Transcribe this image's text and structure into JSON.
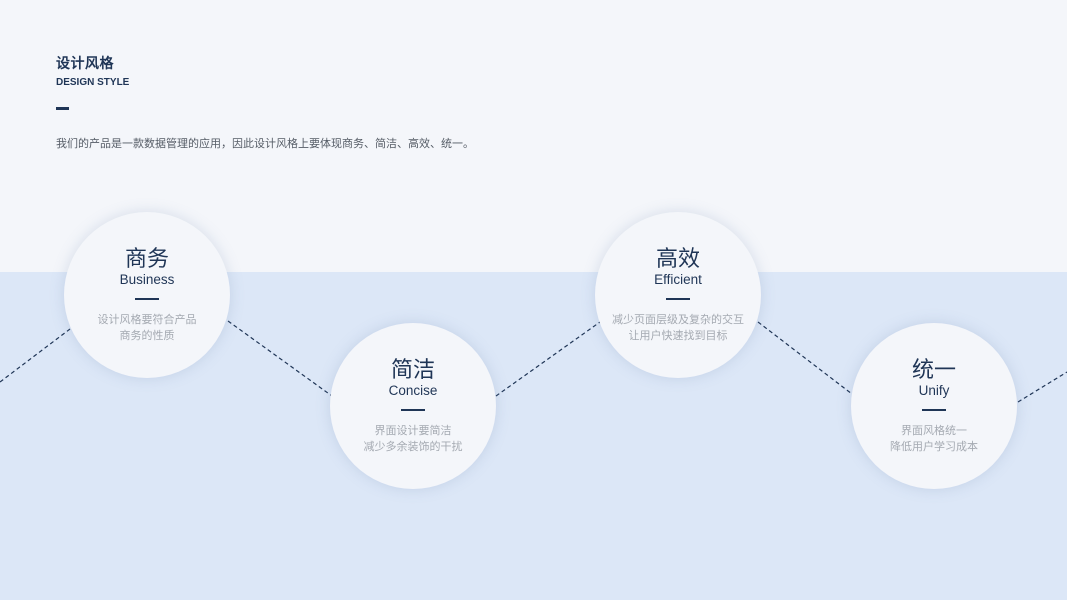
{
  "header": {
    "title_cn": "设计风格",
    "title_en": "DESIGN STYLE",
    "description": "我们的产品是一款数据管理的应用，因此设计风格上要体现商务、简洁、高效、统一。"
  },
  "styles": [
    {
      "title": "商务",
      "subtitle": "Business",
      "line1": "设计风格要符合产品",
      "line2": "商务的性质"
    },
    {
      "title": "简洁",
      "subtitle": "Concise",
      "line1": "界面设计要简洁",
      "line2": "减少多余装饰的干扰"
    },
    {
      "title": "高效",
      "subtitle": "Efficient",
      "line1": "减少页面层级及复杂的交互",
      "line2": "让用户快速找到目标"
    },
    {
      "title": "统一",
      "subtitle": "Unify",
      "line1": "界面风格统一",
      "line2": "降低用户学习成本"
    }
  ],
  "colors": {
    "primary": "#1f3556",
    "background_top": "#f4f6fa",
    "background_bottom": "#dce7f7",
    "muted_text": "#a4a9b1"
  }
}
